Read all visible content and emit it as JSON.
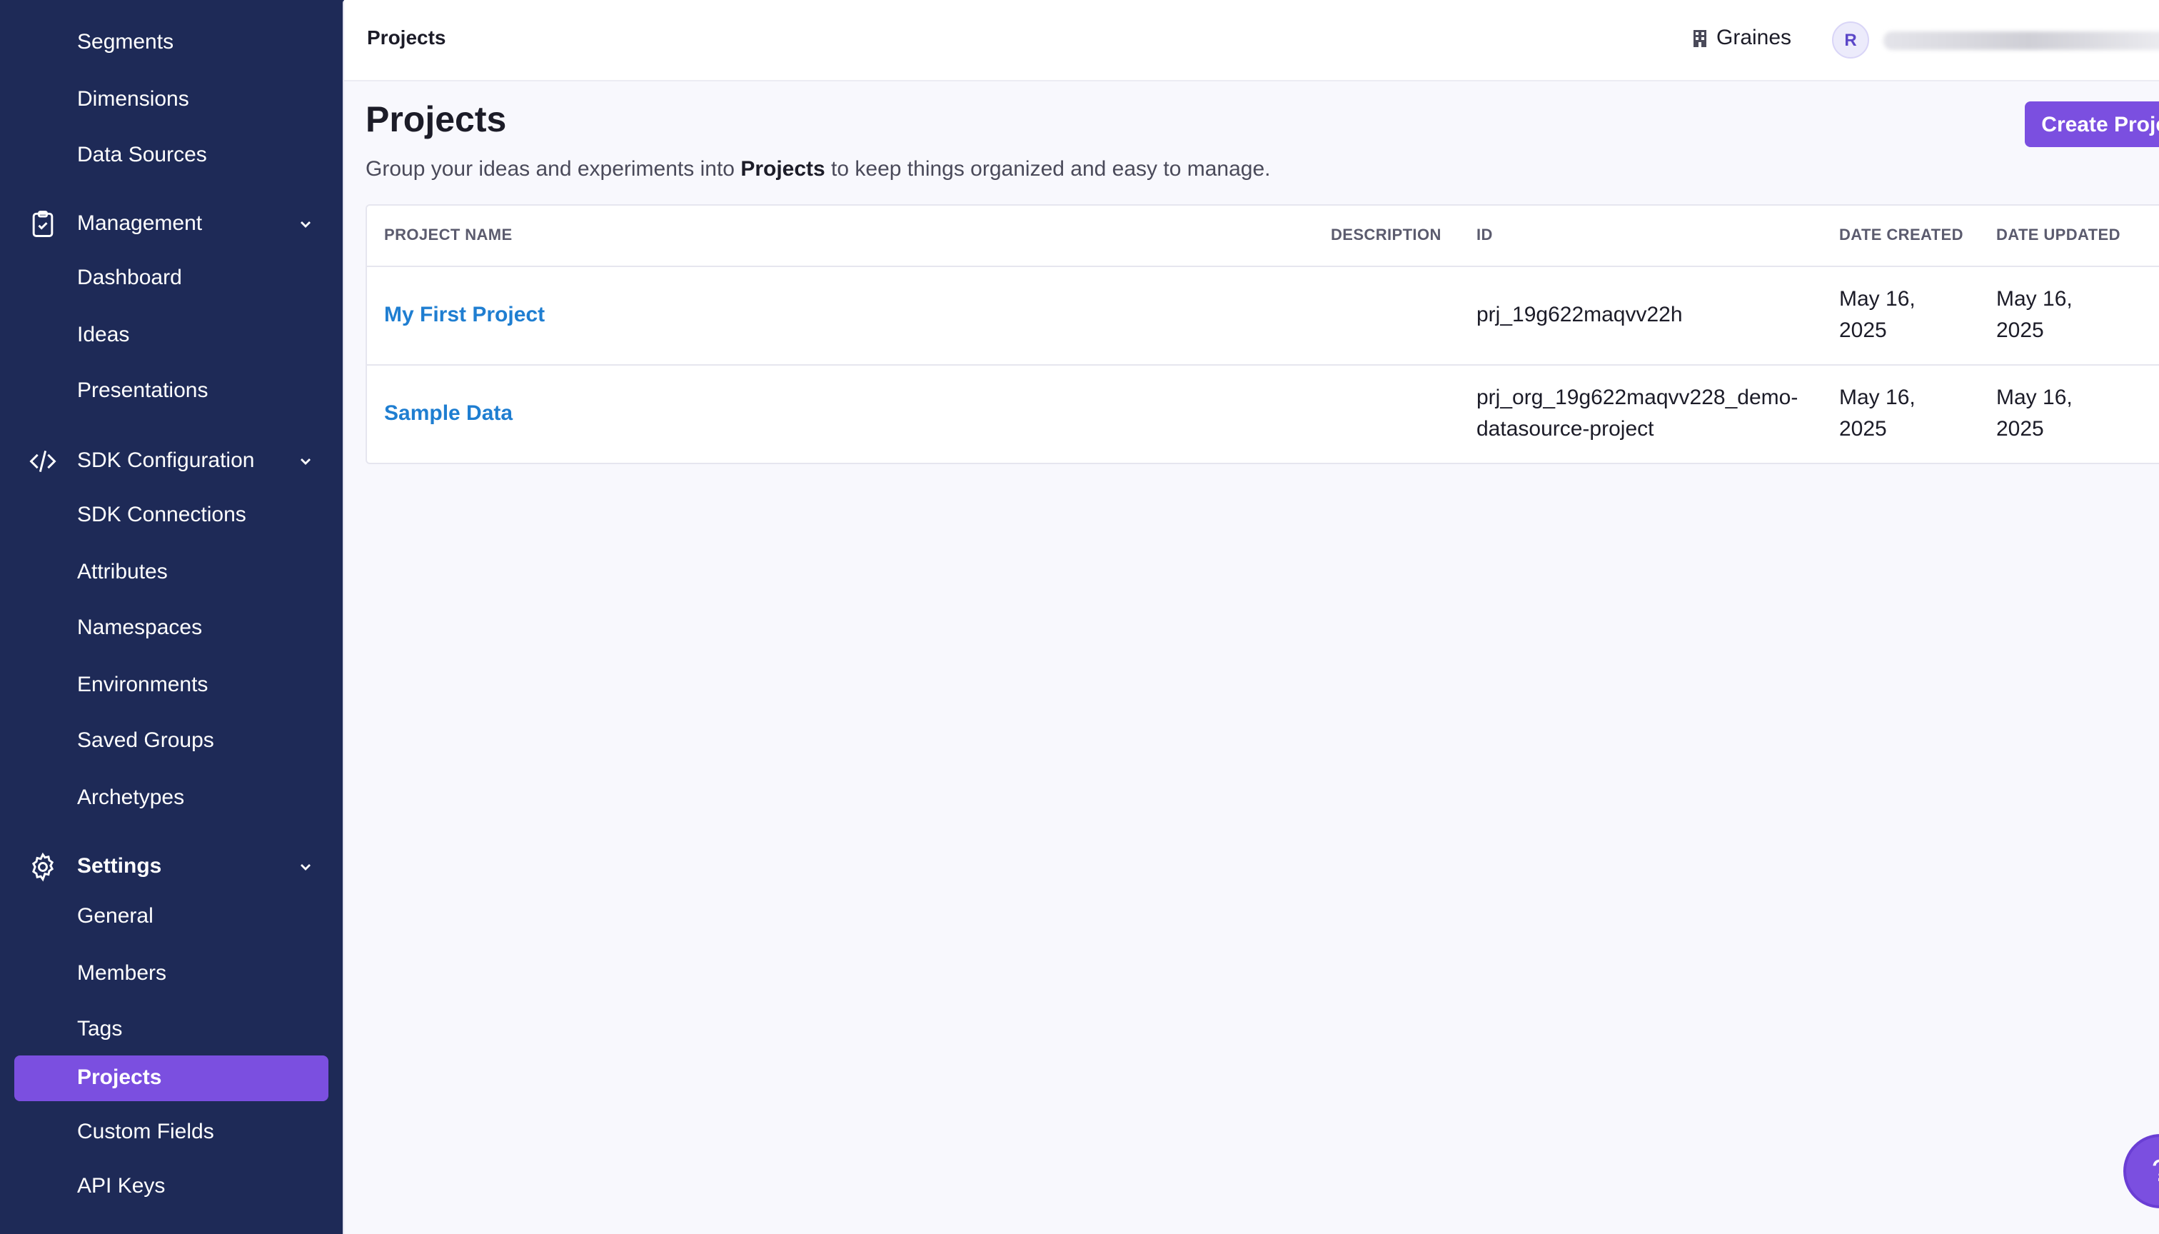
{
  "sidebar": {
    "top_items": [
      {
        "label": "Segments"
      },
      {
        "label": "Dimensions"
      },
      {
        "label": "Data Sources"
      }
    ],
    "management": {
      "label": "Management",
      "icon": "clipboard-check-icon",
      "items": [
        {
          "label": "Dashboard"
        },
        {
          "label": "Ideas"
        },
        {
          "label": "Presentations"
        }
      ]
    },
    "sdk": {
      "label": "SDK Configuration",
      "icon": "code-icon",
      "items": [
        {
          "label": "SDK Connections"
        },
        {
          "label": "Attributes"
        },
        {
          "label": "Namespaces"
        },
        {
          "label": "Environments"
        },
        {
          "label": "Saved Groups"
        },
        {
          "label": "Archetypes"
        }
      ]
    },
    "settings": {
      "label": "Settings",
      "icon": "gear-icon",
      "items": [
        {
          "label": "General"
        },
        {
          "label": "Members"
        },
        {
          "label": "Tags"
        },
        {
          "label": "Projects",
          "active": true
        },
        {
          "label": "Custom Fields"
        },
        {
          "label": "API Keys"
        }
      ]
    },
    "colors": {
      "background": "#1e2a57",
      "active": "#7b4fe0"
    }
  },
  "topbar": {
    "breadcrumb": "Projects",
    "org_name": "Graines",
    "avatar_initial": "R"
  },
  "page": {
    "title": "Projects",
    "subtitle_pre": "Group your ideas and experiments into ",
    "subtitle_bold": "Projects",
    "subtitle_post": " to keep things organized and easy to manage.",
    "create_button": "Create Project"
  },
  "table": {
    "columns": [
      "PROJECT NAME",
      "DESCRIPTION",
      "ID",
      "DATE CREATED",
      "DATE UPDATED"
    ],
    "rows": [
      {
        "name": "My First Project",
        "description": "",
        "id_line1": "prj_19g622maqvv22h",
        "id_line2": "",
        "created_line1": "May 16,",
        "created_line2": "2025",
        "updated_line1": "May 16,",
        "updated_line2": "2025"
      },
      {
        "name": "Sample Data",
        "description": "",
        "id_line1": "prj_org_19g622maqvv228_demo-",
        "id_line2": "datasource-project",
        "created_line1": "May 16,",
        "created_line2": "2025",
        "updated_line1": "May 16,",
        "updated_line2": "2025"
      }
    ]
  },
  "help_button": "?"
}
